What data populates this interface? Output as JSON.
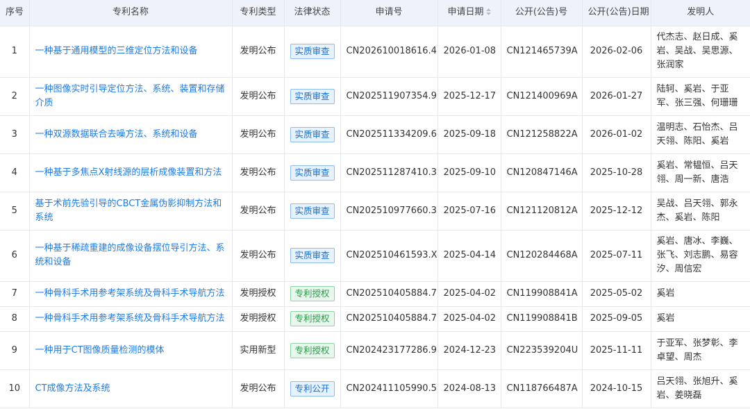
{
  "headers": {
    "index": "序号",
    "name": "专利名称",
    "type": "专利类型",
    "status": "法律状态",
    "app_no": "申请号",
    "app_date": "申请日期",
    "pub_no": "公开(公告)号",
    "pub_date": "公开(公告)日期",
    "inventors": "发明人"
  },
  "colors": {
    "header_bg": "#eef3fb",
    "link": "#1e7be6",
    "badge_blue": "#1a6fd6",
    "badge_green": "#2a9a4a"
  },
  "rows": [
    {
      "index": "1",
      "name": "一种基于通用模型的三维定位方法和设备",
      "type": "发明公布",
      "status": "实质审查",
      "status_color": "blue",
      "app_no": "CN202610018616.4",
      "app_date": "2026-01-08",
      "pub_no": "CN121465739A",
      "pub_date": "2026-02-06",
      "inventors": "代杰志、赵日成、奚岩、吴战、吴思源、张润家"
    },
    {
      "index": "2",
      "name": "一种图像实时引导定位方法、系统、装置和存储介质",
      "type": "发明公布",
      "status": "实质审查",
      "status_color": "blue",
      "app_no": "CN202511907354.9",
      "app_date": "2025-12-17",
      "pub_no": "CN121400969A",
      "pub_date": "2026-01-27",
      "inventors": "陆轲、奚岩、于亚军、张三强、何珊珊"
    },
    {
      "index": "3",
      "name": "一种双源数据联合去噪方法、系统和设备",
      "type": "发明公布",
      "status": "实质审查",
      "status_color": "blue",
      "app_no": "CN202511334209.6",
      "app_date": "2025-09-18",
      "pub_no": "CN121258822A",
      "pub_date": "2026-01-02",
      "inventors": "温明志、石怡杰、吕天翎、陈阳、奚岩"
    },
    {
      "index": "4",
      "name": "一种基于多焦点X射线源的层析成像装置和方法",
      "type": "发明公布",
      "status": "实质审查",
      "status_color": "blue",
      "app_no": "CN202511287410.3",
      "app_date": "2025-09-10",
      "pub_no": "CN120847146A",
      "pub_date": "2025-10-28",
      "inventors": "奚岩、常韫恒、吕天翎、周一新、唐浩"
    },
    {
      "index": "5",
      "name": "基于术前先验引导的CBCT金属伪影抑制方法和系统",
      "type": "发明公布",
      "status": "实质审查",
      "status_color": "blue",
      "app_no": "CN202510977660.3",
      "app_date": "2025-07-16",
      "pub_no": "CN121120812A",
      "pub_date": "2025-12-12",
      "inventors": "吴战、吕天翎、郭永杰、奚岩、陈阳"
    },
    {
      "index": "6",
      "name": "一种基于稀疏重建的成像设备摆位导引方法、系统和设备",
      "type": "发明公布",
      "status": "实质审查",
      "status_color": "blue",
      "app_no": "CN202510461593.X",
      "app_date": "2025-04-14",
      "pub_no": "CN120284468A",
      "pub_date": "2025-07-11",
      "inventors": "奚岩、唐冰、李巍、张飞、刘志鹏、易容汐、周信宏"
    },
    {
      "index": "7",
      "name": "一种骨科手术用参考架系统及骨科手术导航方法",
      "type": "发明授权",
      "status": "专利授权",
      "status_color": "green",
      "app_no": "CN202510405884.7",
      "app_date": "2025-04-02",
      "pub_no": "CN119908841A",
      "pub_date": "2025-05-02",
      "inventors": "奚岩"
    },
    {
      "index": "8",
      "name": "一种骨科手术用参考架系统及骨科手术导航方法",
      "type": "发明授权",
      "status": "专利授权",
      "status_color": "green",
      "app_no": "CN202510405884.7",
      "app_date": "2025-04-02",
      "pub_no": "CN119908841B",
      "pub_date": "2025-09-05",
      "inventors": "奚岩"
    },
    {
      "index": "9",
      "name": "一种用于CT图像质量检测的模体",
      "type": "实用新型",
      "status": "专利授权",
      "status_color": "green",
      "app_no": "CN202423177286.9",
      "app_date": "2024-12-23",
      "pub_no": "CN223539204U",
      "pub_date": "2025-11-11",
      "inventors": "于亚军、张梦彰、李卓望、周杰"
    },
    {
      "index": "10",
      "name": "CT成像方法及系统",
      "type": "发明公布",
      "status": "专利公开",
      "status_color": "blue",
      "app_no": "CN202411105990.5",
      "app_date": "2024-08-13",
      "pub_no": "CN118766487A",
      "pub_date": "2024-10-15",
      "inventors": "吕天翎、张旭升、奚岩、姜晓磊"
    }
  ]
}
